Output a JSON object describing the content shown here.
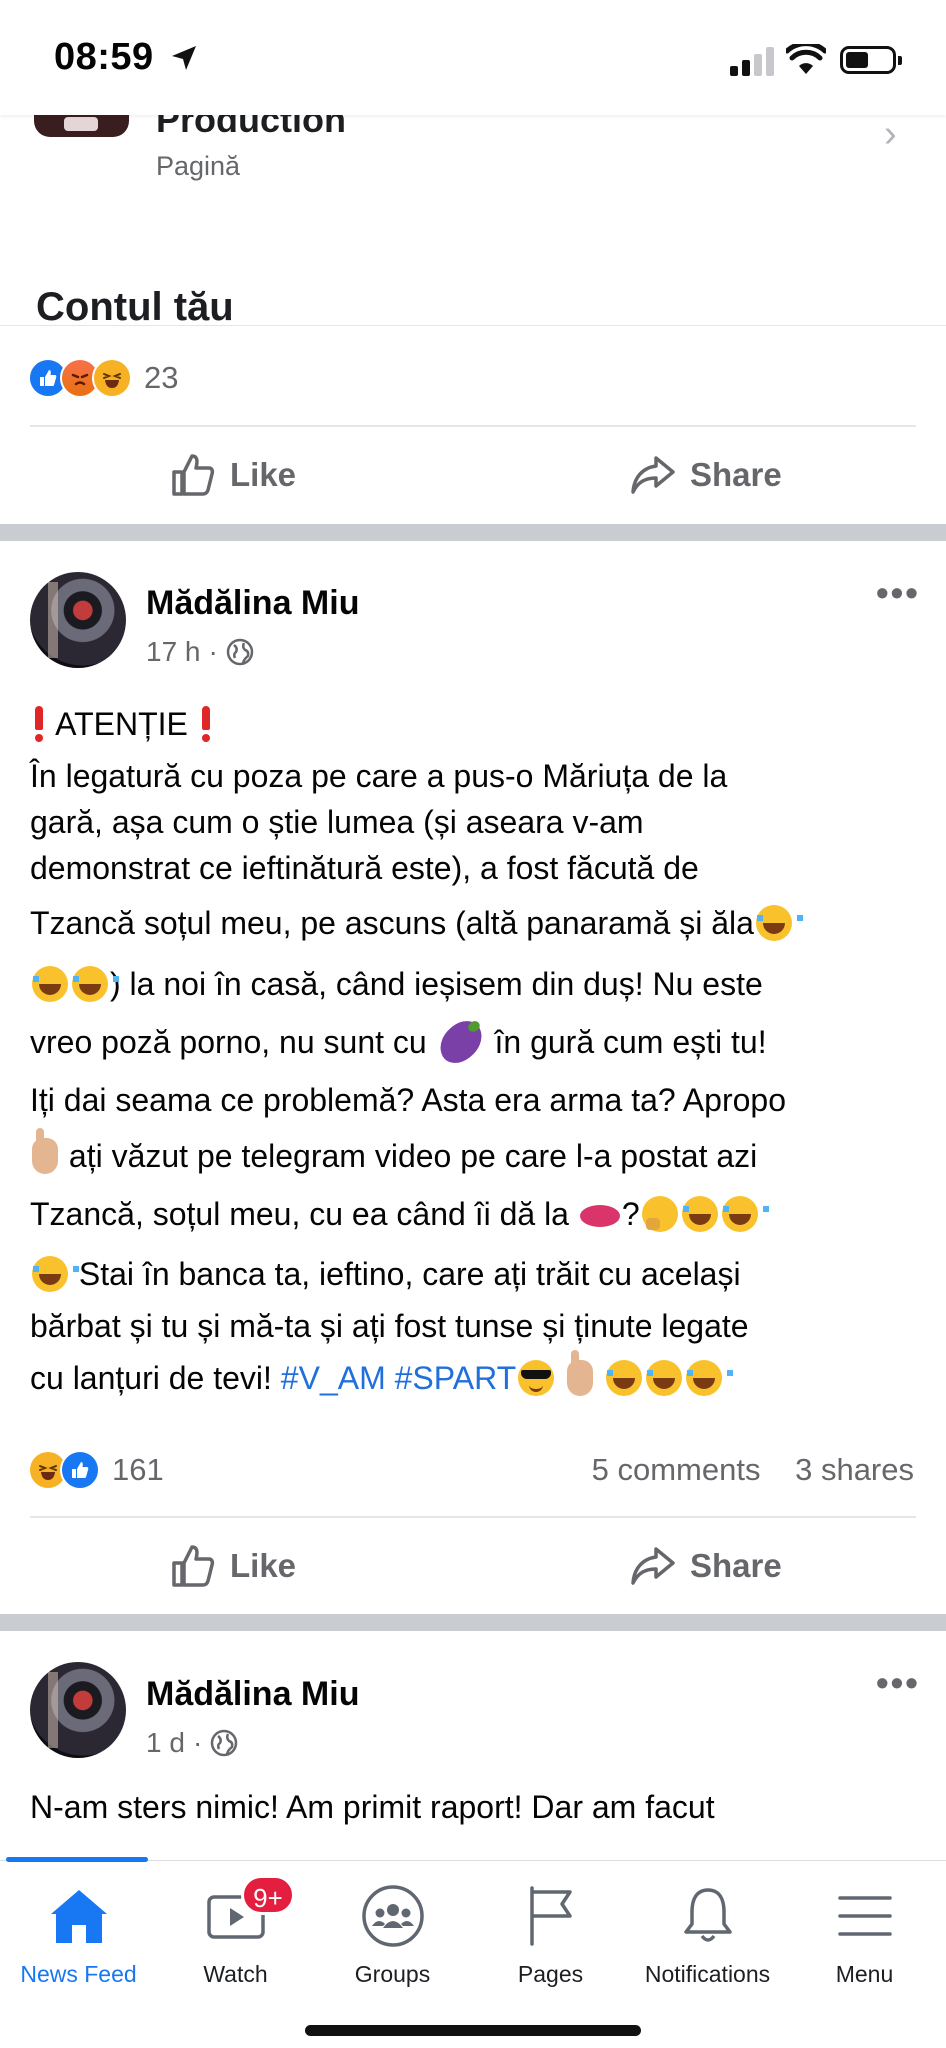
{
  "status_bar": {
    "time": "08:59"
  },
  "shared_post": {
    "title": "Production",
    "subtitle": "Pagină",
    "heading": "Contul tău",
    "reaction_count": "23",
    "like_label": "Like",
    "share_label": "Share"
  },
  "posts": [
    {
      "author": "Mădălina Miu",
      "time": "17 h",
      "dot": "·",
      "text": {
        "l1": "ATENȚIE",
        "l2": "În legatură cu poza pe care a pus-o Măriuța de la",
        "l3": "gară, așa cum o știe lumea (și aseara v-am",
        "l4": "demonstrat ce ieftinătură este), a fost făcută de",
        "l5": "Tzancă soțul meu, pe ascuns (altă panaramă și ăla",
        "l6": ") la noi în casă, când ieșisem din duș! Nu este",
        "l7a": "vreo poză porno, nu sunt cu",
        "l7b": "în gură cum ești tu!",
        "l8": "Iți dai seama ce problemă? Asta era arma ta? Apropo",
        "l9": "ați văzut pe telegram video pe care l-a postat azi",
        "l10a": "Tzancă, soțul meu, cu ea când îi dă la",
        "l10b": "?",
        "l11": "Stai în banca ta, ieftino, care ați trăit cu același",
        "l12": "bărbat și tu și mă-ta și ați fost tunse și ținute legate",
        "l13": "cu lanțuri de tevi!",
        "hashtag1": "#V_AM",
        "hashtag2": "#SPART"
      },
      "reaction_count": "161",
      "comments": "5 comments",
      "shares": "3 shares",
      "like_label": "Like",
      "share_label": "Share"
    },
    {
      "author": "Mădălina Miu",
      "time": "1 d",
      "dot": "·",
      "text": {
        "l1": "N-am sters nimic! Am primit raport! Dar am facut"
      }
    }
  ],
  "bottom_nav": {
    "items": [
      {
        "label": "News Feed",
        "icon": "home-icon"
      },
      {
        "label": "Watch",
        "icon": "watch-icon",
        "badge": "9+"
      },
      {
        "label": "Groups",
        "icon": "groups-icon"
      },
      {
        "label": "Pages",
        "icon": "flag-icon"
      },
      {
        "label": "Notifications",
        "icon": "bell-icon"
      },
      {
        "label": "Menu",
        "icon": "menu-icon"
      }
    ]
  },
  "colors": {
    "accent": "#1877f2",
    "badge": "#e41e3f",
    "hashtag": "#216fdb",
    "secondary_text": "#65676b",
    "separator": "#c9ccd1"
  }
}
